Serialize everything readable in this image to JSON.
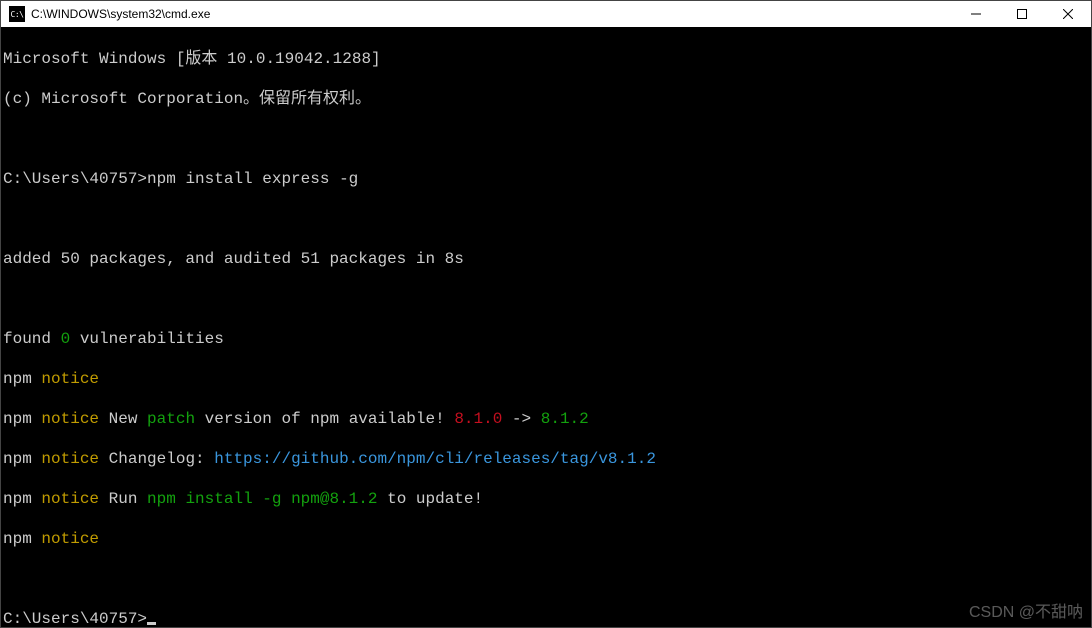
{
  "titlebar": {
    "icon_label": "C:\\",
    "title": "C:\\WINDOWS\\system32\\cmd.exe"
  },
  "terminal": {
    "line1": "Microsoft Windows [版本 10.0.19042.1288]",
    "line2": "(c) Microsoft Corporation。保留所有权利。",
    "prompt1_prefix": "C:\\Users\\40757>",
    "prompt1_cmd": "npm install express -g",
    "added_line": "added 50 packages, and audited 51 packages in 8s",
    "found_prefix": "found ",
    "found_zero": "0",
    "found_suffix": " vulnerabilities",
    "npm": "npm",
    "notice": " notice",
    "notice2_a": " New ",
    "notice2_patch": "patch",
    "notice2_b": " version of npm available! ",
    "ver_old": "8.1.0",
    "arrow": " -> ",
    "ver_new": "8.1.2",
    "notice3_a": " Changelog: ",
    "changelog_url": "https://github.com/npm/cli/releases/tag/v8.1.2",
    "notice4_a": " Run ",
    "notice4_cmd": "npm install -g npm@8.1.2",
    "notice4_b": " to update!",
    "prompt2_prefix": "C:\\Users\\40757>"
  },
  "watermark": "CSDN @不甜呐"
}
